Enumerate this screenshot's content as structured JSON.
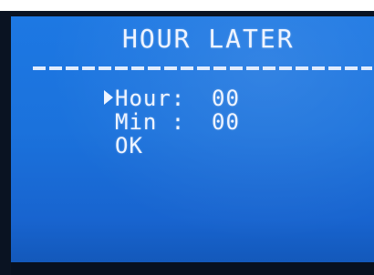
{
  "screen": {
    "title": "HOUR LATER",
    "menu": {
      "hour_label": "Hour:",
      "hour_value": "00",
      "min_label": "Min :",
      "min_value": "00",
      "ok_label": "OK"
    },
    "selected_item": "Hour",
    "colors": {
      "lcd_background": "#1d78e3",
      "lcd_text": "#eef4ff",
      "bezel": "#0a1322"
    },
    "icons": {
      "cursor": "selection-arrow-icon"
    }
  }
}
